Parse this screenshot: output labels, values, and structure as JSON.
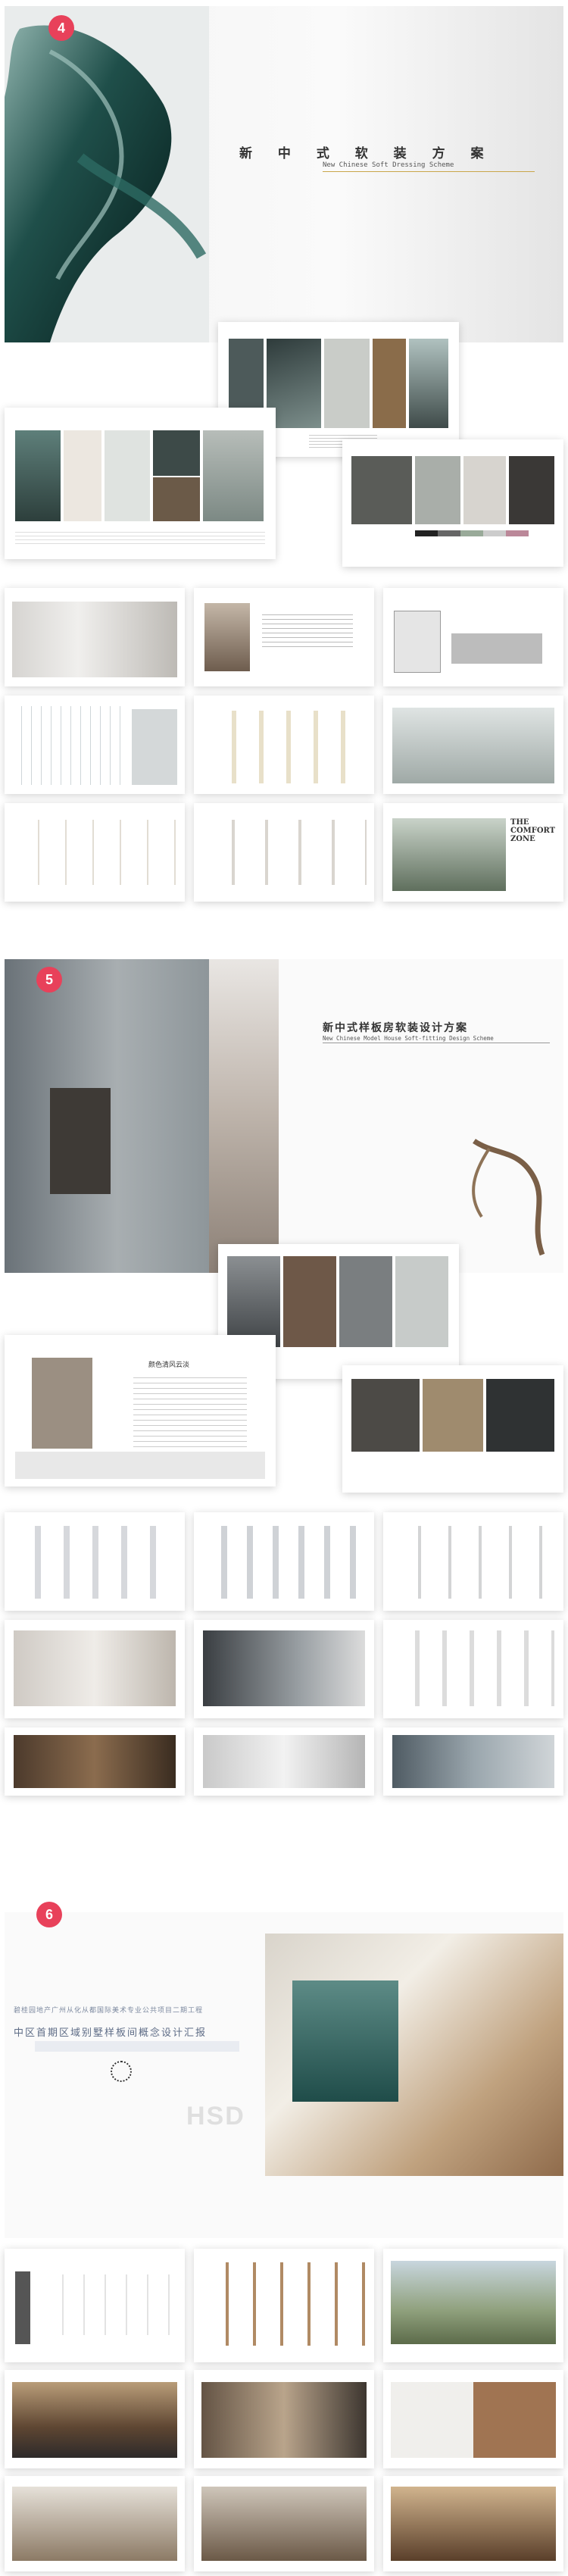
{
  "sections": [
    {
      "number": "4",
      "title_cn": "新 中 式 软 装 方 案",
      "title_en": "New Chinese Soft Dressing Scheme"
    },
    {
      "number": "5",
      "title_cn": "新中式样板房软装设计方案",
      "title_en": "New Chinese Model House Soft-fitting Design Scheme",
      "text_block": "颜色清风云淡"
    },
    {
      "number": "6",
      "title_line1": "碧桂园地产广州从化从都国际美术专业公共项目二期工程",
      "title_cn": "中区首期区域别墅样板间概念设计汇报",
      "watermark": "HSD"
    }
  ],
  "inner_labels": {
    "comfort": "THE COMFORT ZONE"
  },
  "colors": {
    "badge": "#e8415a",
    "accent_gold": "#c9a64a",
    "teal": "#1f4f4a"
  }
}
